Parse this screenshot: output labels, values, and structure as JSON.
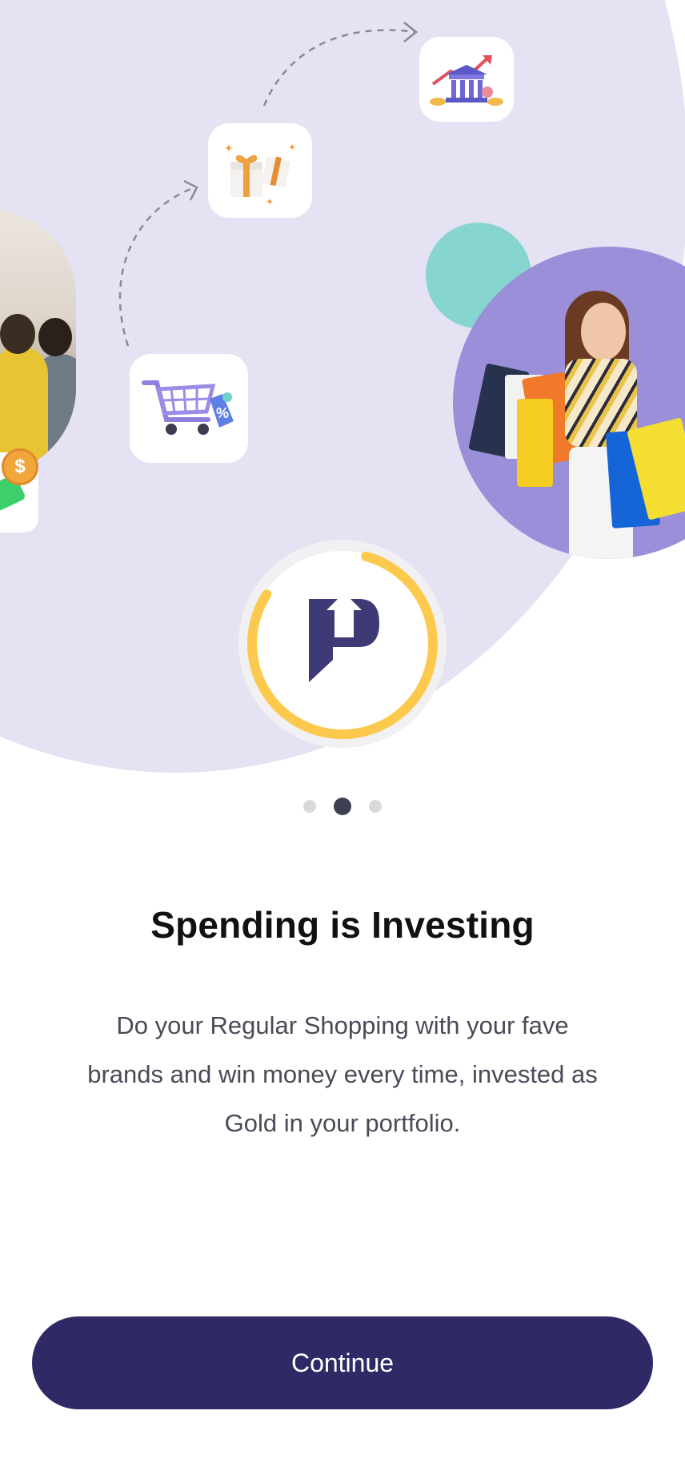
{
  "carousel": {
    "total_pages": 3,
    "active_index": 1
  },
  "onboarding": {
    "title": "Spending is Investing",
    "description": "Do your Regular Shopping with your fave brands and win money every time, invested as Gold in your portfolio."
  },
  "actions": {
    "continue_label": "Continue"
  },
  "illustration": {
    "icons": [
      "bank-growth-icon",
      "gift-boxes-icon",
      "shopping-cart-discount-icon",
      "app-logo-icon",
      "dollar-coin-icon"
    ],
    "coin_symbol": "$",
    "progress_ring_fraction": 0.8
  },
  "colors": {
    "hero_background": "#e4e2f3",
    "primary_button": "#2f2a66",
    "ring": "#fcc94d",
    "logo": "#3e3a75",
    "dot_active": "#3f3f52",
    "dot_inactive": "#d9d9d9",
    "teal_accent": "#86d6cf",
    "photo_background": "#9a8fd8"
  }
}
